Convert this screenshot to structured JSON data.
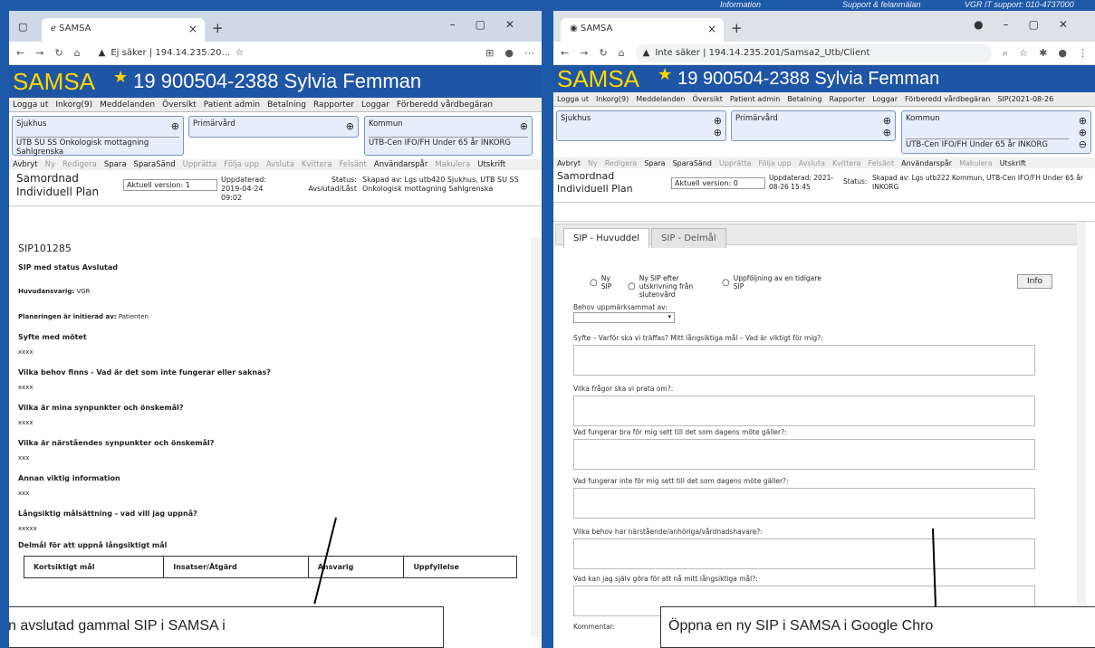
{
  "desktop": {
    "info": "Information",
    "support": "Support & felanmälan",
    "vgr": "VGR IT support: 010-4737000"
  },
  "left": {
    "tab_title": "SAMSA",
    "url": "Ej säker | 194.14.235.20...",
    "banner": {
      "logo": "SAMSA",
      "patient": "19 900504-2388 Sylvia Femman"
    },
    "menu": [
      "Logga ut",
      "Inkorg(9)",
      "Meddelanden",
      "Översikt",
      "Patient admin",
      "Betalning",
      "Rapporter",
      "Loggar",
      "Förberedd vårdbegäran"
    ],
    "orgs": [
      {
        "title": "Sjukhus",
        "sub": "UTB SU SS Onkologisk mottagning Sahlgrenska"
      },
      {
        "title": "Primärvård",
        "sub": ""
      },
      {
        "title": "Kommun",
        "sub": "UTB-Cen IFO/FH Under 65 år INKORG"
      }
    ],
    "actions": [
      "Avbryt",
      "Ny",
      "Redigera",
      "Spara",
      "SparaSänd",
      "Upprätta",
      "Följa upp",
      "Avsluta",
      "Kvittera",
      "Felsänt",
      "Användarspår",
      "Makulera",
      "Utskrift"
    ],
    "header": {
      "title": "Samordnad Individuell Plan",
      "version": "Aktuell version: 1",
      "updated": "Uppdaterad: 2019-04-24 09:02",
      "status_lbl": "Status:",
      "status": "Avslutad/Låst",
      "created": "Skapad av: Lgs utb420 Sjukhus, UTB SU SS Onkologisk mottagning Sahlgrenska"
    },
    "body": {
      "sip_id": "SIP101285",
      "status_line": "SIP med status Avslutad",
      "huvud_lbl": "Huvudansvarig:",
      "huvud": "VGR",
      "init_lbl": "Planeringen är initierad av:",
      "init": "Patienten",
      "sections": [
        {
          "h": "Syfte med mötet",
          "v": "xxxx"
        },
        {
          "h": "Vilka behov finns - Vad är det som inte fungerar eller saknas?",
          "v": "xxxx"
        },
        {
          "h": "Vilka är mina synpunkter och önskemål?",
          "v": "xxxx"
        },
        {
          "h": "Vilka är närståendes synpunkter och önskemål?",
          "v": "xxx"
        },
        {
          "h": "Annan viktig information",
          "v": "xxx"
        },
        {
          "h": "Långsiktig målsättning - vad vill jag uppnå?",
          "v": "xxxxx"
        }
      ],
      "delmal": "Delmål för att uppnå långsiktigt mål",
      "cols": [
        "Kortsiktigt mål",
        "Insatser/Åtgärd",
        "Ansvarig",
        "Uppfyllelse"
      ]
    },
    "caption": "n avslutad gammal SIP i SAMSA i"
  },
  "right": {
    "tab_title": "SAMSA",
    "url": "Inte säker | 194.14.235.201/Samsa2_Utb/Client",
    "banner": {
      "logo": "SAMSA",
      "patient": "19 900504-2388 Sylvia Femman"
    },
    "menu": [
      "Logga ut",
      "Inkorg(9)",
      "Meddelanden",
      "Översikt",
      "Patient admin",
      "Betalning",
      "Rapporter",
      "Loggar",
      "Förberedd vårdbegäran",
      "SIP(2021-08-26"
    ],
    "orgs": [
      {
        "title": "Sjukhus",
        "sub": ""
      },
      {
        "title": "Primärvård",
        "sub": ""
      },
      {
        "title": "Kommun",
        "sub": "UTB-Cen IFO/FH Under 65 år INKORG"
      }
    ],
    "actions": [
      "Avbryt",
      "Ny",
      "Redigera",
      "Spara",
      "SparaSänd",
      "Upprätta",
      "Följa upp",
      "Avsluta",
      "Kvittera",
      "Felsänt",
      "Användarspår",
      "Makulera",
      "Utskrift"
    ],
    "header": {
      "title": "Samordnad Individuell Plan",
      "version": "Aktuell version: 0",
      "updated": "Uppdaterad: 2021-08-26 15:45",
      "status_lbl": "Status:",
      "created": "Skapad av: Lgs utb222 Kommun, UTB-Cen IFO/FH Under 65 år INKORG"
    },
    "tabs": [
      "SIP - Huvuddel",
      "SIP - Delmål"
    ],
    "radios": [
      "Ny SIP",
      "Ny SIP efter utskrivning från slutenvård",
      "Uppföljning av en tidigare SIP"
    ],
    "info_btn": "Info",
    "behov_lbl": "Behov uppmärksammat av:",
    "fields": [
      "Syfte – Varför ska vi träffas? Mitt långsiktiga mål – Vad är viktigt för mig?:",
      "Vilka frågor ska vi prata om?:",
      "Vad fungerar bra för mig sett till det som dagens möte gäller?:",
      "Vad fungerar inte för mig sett till det som dagens möte gäller?:",
      "Vilka behov har närstående/anhöriga/vårdnadshavare?:",
      "Vad kan jag själv göra för att nå mitt långsiktiga mål?:"
    ],
    "kommentar": "Kommentar:",
    "caption": "Öppna en ny SIP i SAMSA i Google Chro"
  }
}
